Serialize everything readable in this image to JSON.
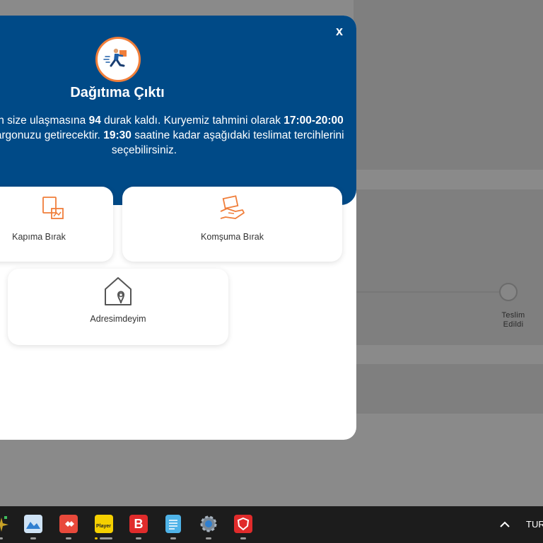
{
  "modal": {
    "close_label": "x",
    "title": "Dağıtıma Çıktı",
    "desc_parts": [
      "Kargonuzun size ulaşmasına ",
      "94",
      " durak kaldı. Kuryemiz tahmini olarak ",
      "17:00-20:00",
      " arasında kargonuzu getirecektir. ",
      "19:30",
      " saatine kadar aşağıdaki teslimat tercihlerini seçebilirsiniz."
    ],
    "options": [
      {
        "label": "Kapıma Bırak",
        "icon": "door-package-icon"
      },
      {
        "label": "Komşuma Bırak",
        "icon": "hand-package-icon"
      },
      {
        "label": "Adresimdeyim",
        "icon": "home-location-icon"
      }
    ]
  },
  "background": {
    "step_label_line1": "Teslim",
    "step_label_line2": "Edildi"
  },
  "taskbar": {
    "apps": [
      "sparkle-app-icon",
      "photo-app-icon",
      "anydesk-icon",
      "player-app-icon",
      "b-app-icon",
      "notepad-icon",
      "settings-gear-icon",
      "security-app-icon"
    ],
    "player_label": "Player",
    "b_label": "B",
    "lang": "TUR"
  },
  "colors": {
    "header_blue": "#004a87",
    "accent_orange": "#f07e3a",
    "taskbar": "#1c1c1c"
  }
}
